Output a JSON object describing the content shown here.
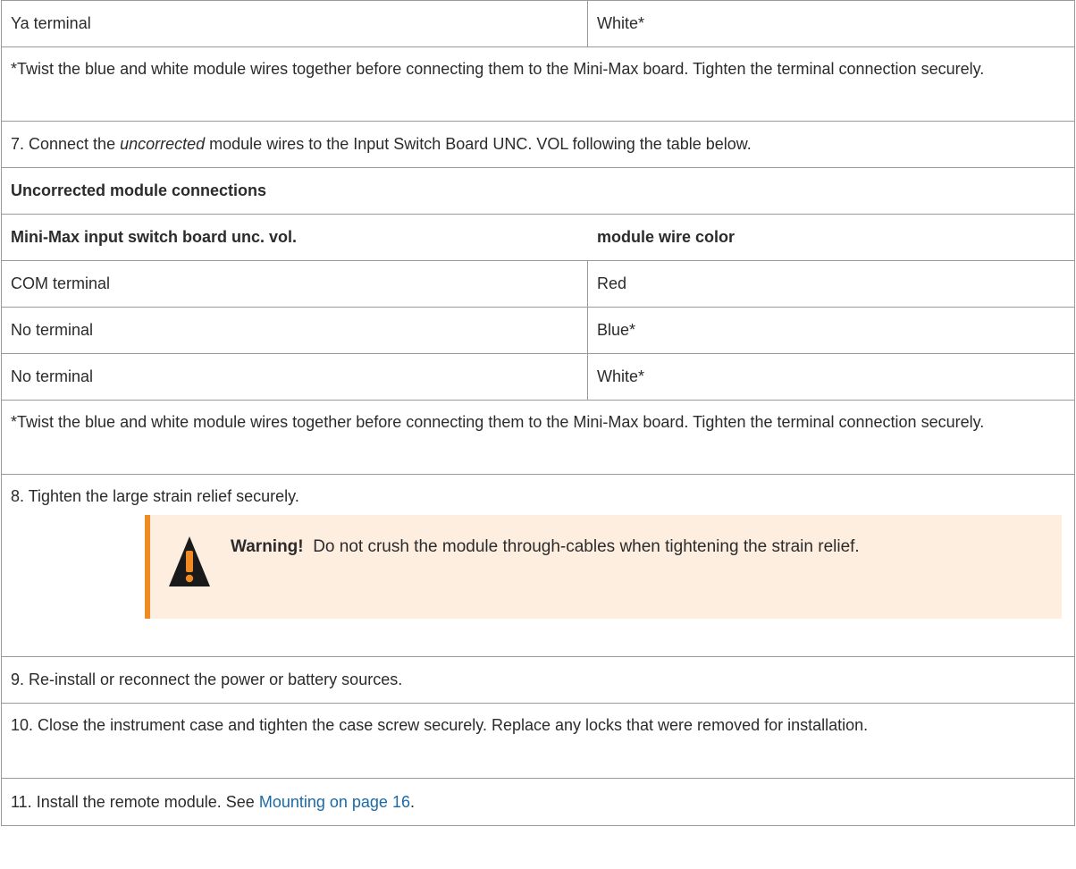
{
  "top_row": {
    "terminal": "Ya terminal",
    "color": "White*"
  },
  "note1": "*Twist the blue and white module wires together before connecting them to the Mini-Max board. Tighten the terminal connection securely.",
  "step7": {
    "prefix": "7. Connect the ",
    "emphasis": "uncorrected",
    "suffix": " module wires to the Input Switch Board UNC. VOL following the table below."
  },
  "table": {
    "title": "Uncorrected module connections",
    "headers": [
      "Mini-Max input switch board unc. vol.",
      "module wire color"
    ],
    "rows": [
      [
        "COM terminal",
        "Red"
      ],
      [
        "No terminal",
        "Blue*"
      ],
      [
        "No terminal",
        "White*"
      ]
    ]
  },
  "note2": "*Twist the blue and white module wires together before connecting them to the Mini-Max board. Tighten the terminal connection securely.",
  "step8": "8. Tighten the large strain relief securely.",
  "warning": {
    "label": "Warning!",
    "text": "Do not crush the module through-cables when tightening the strain relief.",
    "icon": "warning-triangle-icon",
    "accent_color": "#f08a24",
    "background_color": "#fdeee0"
  },
  "step9": "9. Re-install or reconnect the power or battery sources.",
  "step10": "10. Close the instrument case and tighten the case screw securely. Replace any locks that were removed for installation.",
  "step11": {
    "prefix": "11. Install the remote module. See ",
    "link": "Mounting on page 16",
    "suffix": "."
  }
}
